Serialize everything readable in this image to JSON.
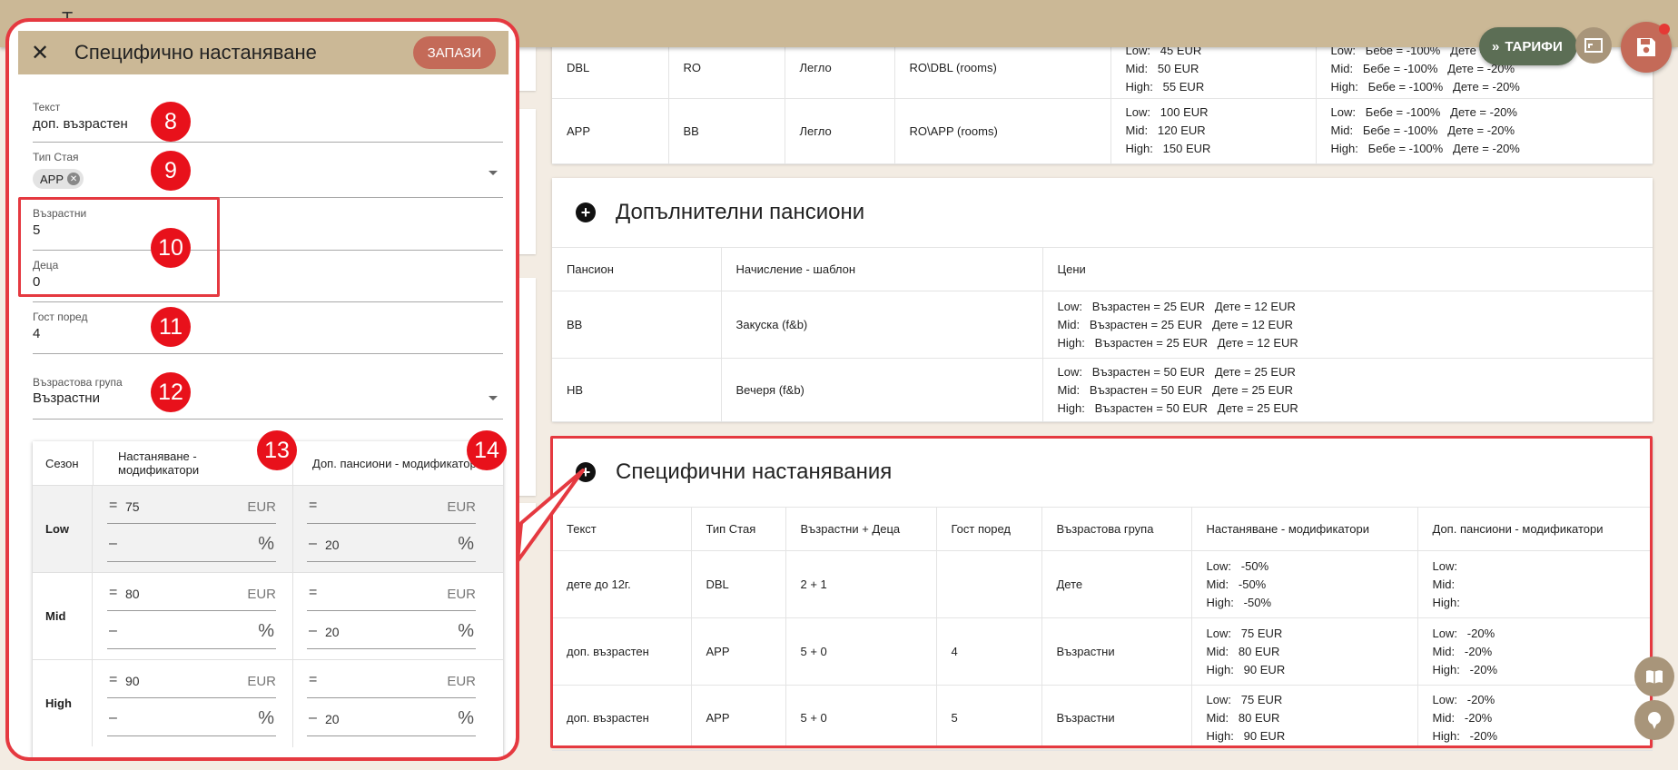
{
  "topbar": {
    "back": "←",
    "title": "Т"
  },
  "actions": {
    "tariffs_label": "ТАРИФИ"
  },
  "rooms_rows": [
    {
      "type": "DBL",
      "board": "RO",
      "bed": "Легло",
      "template": "RO\\DBL (rooms)",
      "prices": [
        "Low:   45 EUR",
        "Mid:   50 EUR",
        "High:   55 EUR"
      ],
      "mods": [
        "Low:   Бебе = -100%   Дете = -20%",
        "Mid:   Бебе = -100%   Дете = -20%",
        "High:   Бебе = -100%   Дете = -20%"
      ]
    },
    {
      "type": "APP",
      "board": "BB",
      "bed": "Легло",
      "template": "RO\\APP (rooms)",
      "prices": [
        "Low:   100 EUR",
        "Mid:   120 EUR",
        "High:   150 EUR"
      ],
      "mods": [
        "Low:   Бебе = -100%   Дете = -20%",
        "Mid:   Бебе = -100%   Дете = -20%",
        "High:   Бебе = -100%   Дете = -20%"
      ]
    }
  ],
  "extra_boards": {
    "title": "Допълнителни пансиони",
    "headers": [
      "Пансион",
      "Начисление - шаблон",
      "Цени"
    ],
    "rows": [
      {
        "board": "BB",
        "template": "Закуска (f&b)",
        "prices": [
          "Low:   Възрастен = 25 EUR   Дете = 12 EUR",
          "Mid:   Възрастен = 25 EUR   Дете = 12 EUR",
          "High:   Възрастен = 25 EUR   Дете = 12 EUR"
        ]
      },
      {
        "board": "HB",
        "template": "Вечеря (f&b)",
        "prices": [
          "Low:   Възрастен = 50 EUR   Дете = 25 EUR",
          "Mid:   Възрастен = 50 EUR   Дете = 25 EUR",
          "High:   Възрастен = 50 EUR   Дете = 25 EUR"
        ]
      }
    ]
  },
  "specific": {
    "title": "Специфични настанявания",
    "headers": [
      "Текст",
      "Тип Стая",
      "Възрастни + Деца",
      "Гост поред",
      "Възрастова група",
      "Настаняване - модификатори",
      "Доп. пансиони - модификатори"
    ],
    "rows": [
      {
        "text": "дете до 12г.",
        "room": "DBL",
        "ac": "2 + 1",
        "guest": "",
        "group": "Дете",
        "acc": [
          "Low:   -50%",
          "Mid:   -50%",
          "High:   -50%"
        ],
        "extra": [
          "Low:",
          "Mid:",
          "High:"
        ]
      },
      {
        "text": "доп. възрастен",
        "room": "APP",
        "ac": "5 + 0",
        "guest": "4",
        "group": "Възрастни",
        "acc": [
          "Low:   75 EUR",
          "Mid:   80 EUR",
          "High:   90 EUR"
        ],
        "extra": [
          "Low:   -20%",
          "Mid:   -20%",
          "High:   -20%"
        ]
      },
      {
        "text": "доп. възрастен",
        "room": "APP",
        "ac": "5 + 0",
        "guest": "5",
        "group": "Възрастни",
        "acc": [
          "Low:   75 EUR",
          "Mid:   80 EUR",
          "High:   90 EUR"
        ],
        "extra": [
          "Low:   -20%",
          "Mid:   -20%",
          "High:   -20%"
        ]
      }
    ]
  },
  "panel": {
    "title": "Специфично настаняване",
    "save": "ЗАПАЗИ",
    "text_label": "Текст",
    "text_value": "доп. възрастен",
    "room_label": "Тип Стая",
    "room_chip": "APP",
    "adults_label": "Възрастни",
    "adults_value": "5",
    "children_label": "Деца",
    "children_value": "0",
    "guest_label": "Гост поред",
    "guest_value": "4",
    "group_label": "Възрастова група",
    "group_value": "Възрастни",
    "mod_headers": {
      "season": "Сезон",
      "acc": "Настаняване - модификатори",
      "extra": "Доп. пансиони - модификатори"
    },
    "seasons": [
      {
        "name": "Low",
        "acc_eq": "75",
        "acc_pct": "",
        "ext_eq": "",
        "ext_pct": "20"
      },
      {
        "name": "Mid",
        "acc_eq": "80",
        "acc_pct": "",
        "ext_eq": "",
        "ext_pct": "20"
      },
      {
        "name": "High",
        "acc_eq": "90",
        "acc_pct": "",
        "ext_eq": "",
        "ext_pct": "20"
      }
    ],
    "eq_sign": "=",
    "minus_sign": "–",
    "currency": "EUR",
    "percent": "%"
  },
  "badges": [
    "8",
    "9",
    "10",
    "11",
    "12",
    "13",
    "14"
  ],
  "colors": {
    "accent": "#c46a58",
    "header": "#cbb896",
    "highlight": "#e53940"
  }
}
